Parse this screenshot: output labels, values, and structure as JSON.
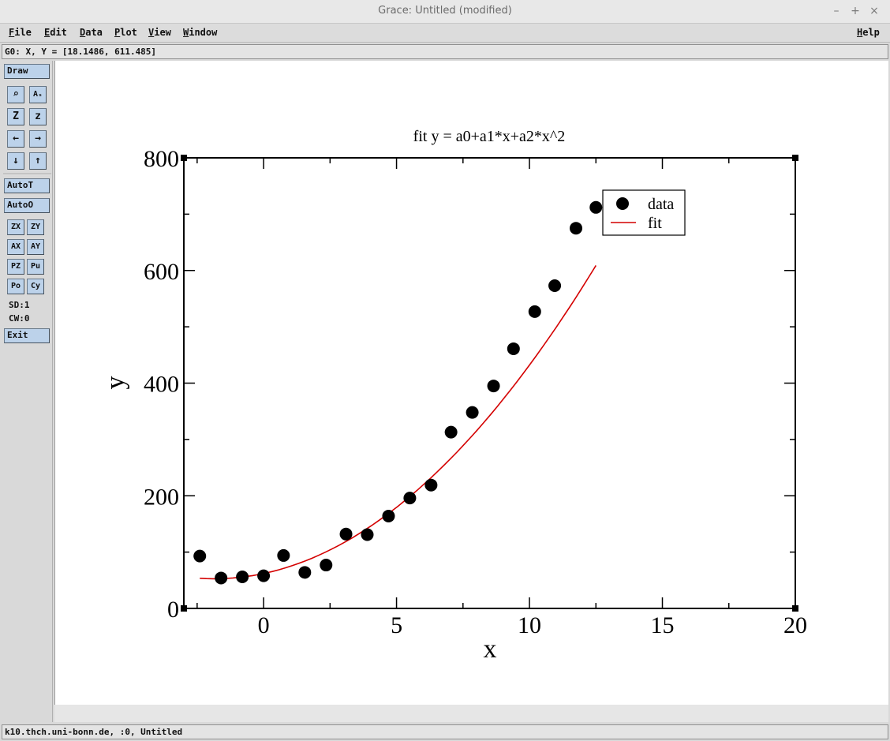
{
  "window": {
    "title": "Grace: Untitled (modified)",
    "minimize_glyph": "–",
    "maximize_glyph": "+",
    "close_glyph": "×"
  },
  "menubar": {
    "items": [
      {
        "hot": "F",
        "rest": "ile"
      },
      {
        "hot": "E",
        "rest": "dit"
      },
      {
        "hot": "D",
        "rest": "ata"
      },
      {
        "hot": "P",
        "rest": "lot"
      },
      {
        "hot": "V",
        "rest": "iew"
      },
      {
        "hot": "W",
        "rest": "indow"
      }
    ],
    "help": {
      "hot": "H",
      "rest": "elp"
    }
  },
  "locator": "G0: X, Y = [18.1486, 611.485]",
  "toolbar": {
    "draw": "Draw",
    "zoom_icon": "⌕",
    "autoscale_icon": "Aₛ",
    "zoom_in_icon": "Z",
    "zoom_out_icon": "z",
    "left_icon": "←",
    "right_icon": "→",
    "down_icon": "↓",
    "up_icon": "↑",
    "autot": "AutoT",
    "autoo": "AutoO",
    "zx": "ZX",
    "zy": "ZY",
    "ax": "AX",
    "ay": "AY",
    "pz": "PZ",
    "pu": "Pu",
    "po": "Po",
    "cy": "Cy",
    "sd": "SD:1",
    "cw": "CW:0",
    "exit": "Exit"
  },
  "status": "k10.thch.uni-bonn.de, :0, Untitled",
  "chart_data": {
    "type": "scatter",
    "title": "fit y = a0+a1*x+a2*x^2",
    "xlabel": "x",
    "ylabel": "y",
    "xlim": [
      -3,
      20
    ],
    "ylim": [
      0,
      800
    ],
    "x_ticks": [
      0,
      5,
      10,
      15,
      20
    ],
    "y_ticks": [
      0,
      200,
      400,
      600,
      800
    ],
    "x_minor_step": 2.5,
    "y_minor_step": 100,
    "legend_position": "top-right",
    "series": [
      {
        "name": "data",
        "style": "markers",
        "color": "#000000",
        "x": [
          -2.4,
          -1.6,
          -0.8,
          0.0,
          0.75,
          1.55,
          2.35,
          3.1,
          3.9,
          4.7,
          5.5,
          6.3,
          7.05,
          7.85,
          8.65,
          9.4,
          10.2,
          10.95,
          11.75,
          12.5
        ],
        "y": [
          93,
          54,
          56,
          58,
          94,
          64,
          77,
          132,
          131,
          164,
          196,
          219,
          313,
          348,
          395,
          461,
          527,
          573,
          675,
          712
        ]
      },
      {
        "name": "fit",
        "style": "line",
        "color": "#d40000",
        "coefficients": [
          62,
          10,
          2.7
        ],
        "x_range": [
          -2.4,
          12.5
        ]
      }
    ]
  }
}
